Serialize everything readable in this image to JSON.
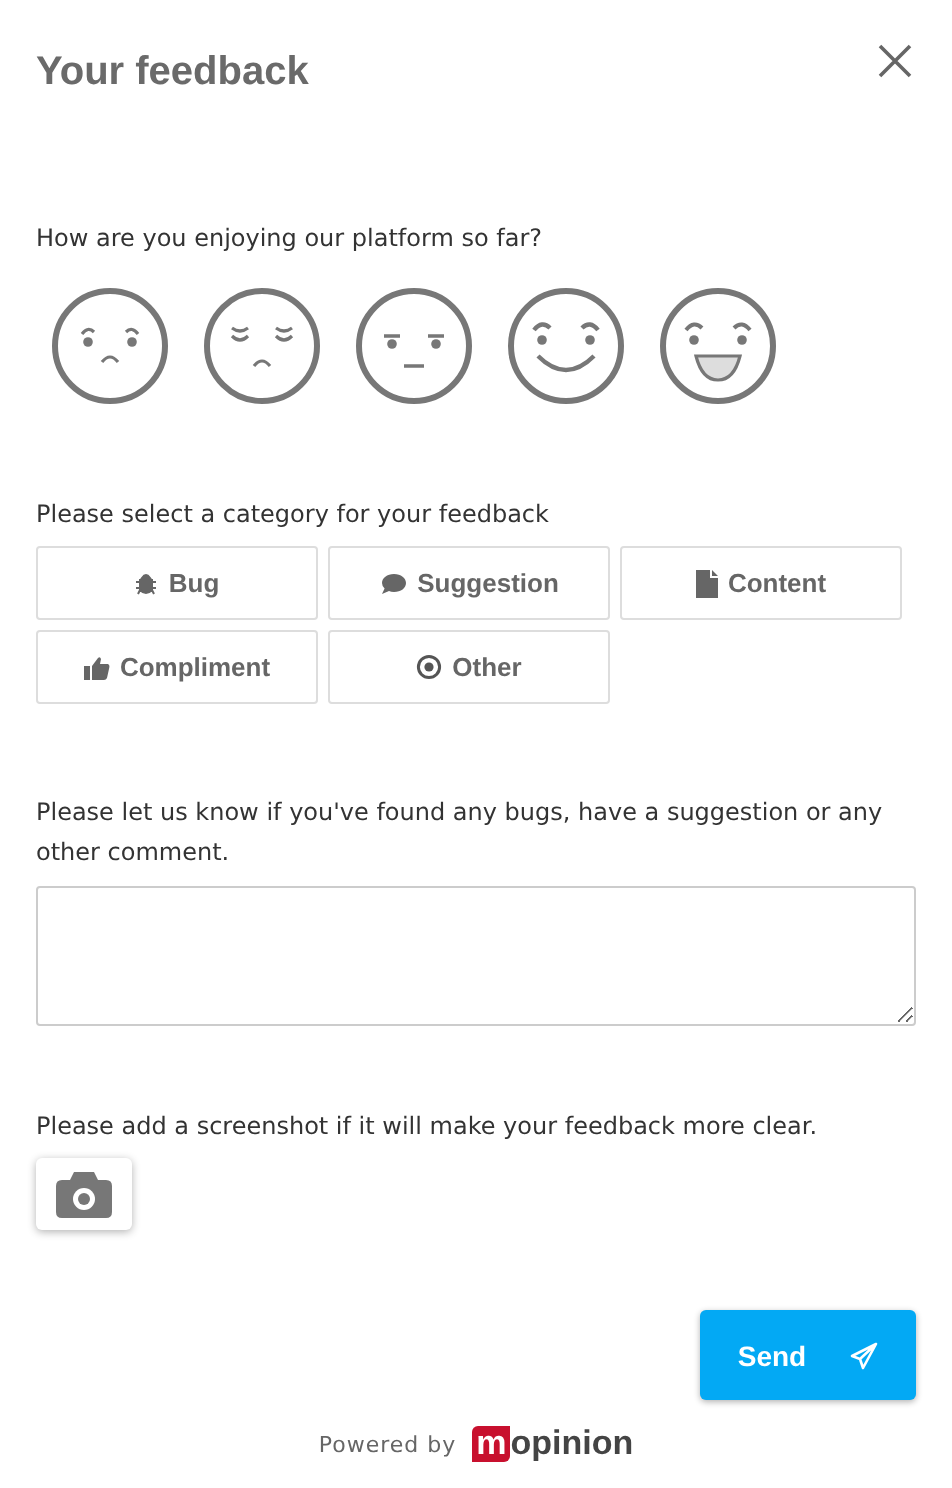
{
  "title": "Your feedback",
  "rating": {
    "question": "How are you enjoying our platform so far?",
    "faces": [
      {
        "kind": "angry",
        "selected": false
      },
      {
        "kind": "sad",
        "selected": false
      },
      {
        "kind": "neutral",
        "selected": false
      },
      {
        "kind": "happy",
        "selected": false
      },
      {
        "kind": "delighted",
        "selected": false
      }
    ]
  },
  "category": {
    "label": "Please select a category for your feedback",
    "options": [
      {
        "label": "Bug",
        "kind": "bug",
        "selected": false
      },
      {
        "label": "Suggestion",
        "kind": "suggestion",
        "selected": false
      },
      {
        "label": "Content",
        "kind": "content",
        "selected": false
      },
      {
        "label": "Compliment",
        "kind": "compliment",
        "selected": false
      },
      {
        "label": "Other",
        "kind": "other",
        "selected": false
      }
    ]
  },
  "comment": {
    "label": "Please let us know if you've found any bugs, have a suggestion or any other comment."
  },
  "screenshot": {
    "label": "Please add a screenshot if it will make your feedback more clear."
  },
  "send": "Send",
  "footer": {
    "powered": "Powered by",
    "logo_mark": "m",
    "logo_text": "opinion"
  }
}
